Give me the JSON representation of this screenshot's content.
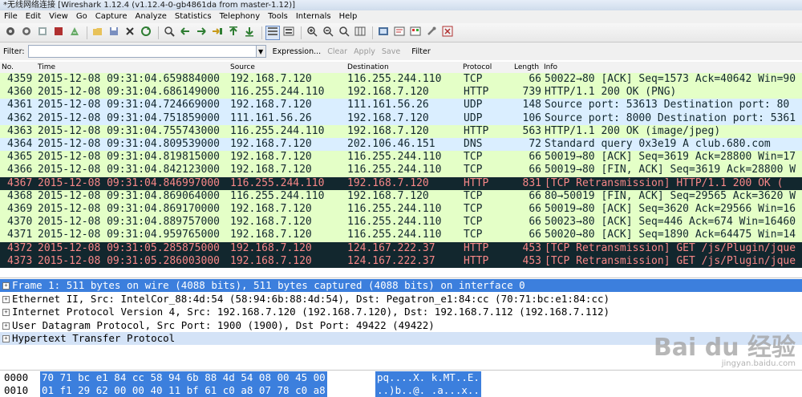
{
  "window": {
    "title": "*无线网络连接   [Wireshark 1.12.4  (v1.12.4-0-gb4861da from master-1.12)]"
  },
  "menu": [
    "File",
    "Edit",
    "View",
    "Go",
    "Capture",
    "Analyze",
    "Statistics",
    "Telephony",
    "Tools",
    "Internals",
    "Help"
  ],
  "toolbar": {
    "icons": [
      "interface-list-icon",
      "capture-options-icon",
      "start-capture-icon",
      "stop-capture-icon",
      "restart-capture-icon",
      "open-file-icon",
      "save-file-icon",
      "close-file-icon",
      "reload-icon",
      "find-packet-icon",
      "go-back-icon",
      "go-forward-icon",
      "go-to-packet-icon",
      "go-first-icon",
      "go-last-icon",
      "colorize-icon",
      "auto-scroll-icon",
      "zoom-in-icon",
      "zoom-out-icon",
      "zoom-normal-icon",
      "resize-columns-icon",
      "capture-filters-icon",
      "display-filters-icon",
      "coloring-rules-icon",
      "preferences-icon",
      "help-icon"
    ]
  },
  "filter": {
    "label": "Filter:",
    "value": "",
    "expression": "Expression...",
    "clear": "Clear",
    "apply": "Apply",
    "save": "Save",
    "filter_btn": "Filter"
  },
  "columns": {
    "no": "No.",
    "time": "Time",
    "source": "Source",
    "destination": "Destination",
    "protocol": "Protocol",
    "length": "Length",
    "info": "Info"
  },
  "colors": {
    "green": "#e4ffc7",
    "blue": "#daeeff",
    "dark": "#12272e",
    "red_text": "#f78787",
    "selected": "#3c7fdd"
  },
  "packets": [
    {
      "no": "4359",
      "time": "2015-12-08 09:31:04.659884000",
      "src": "192.168.7.120",
      "dst": "116.255.244.110",
      "proto": "TCP",
      "len": "66",
      "info": "50022→80 [ACK] Seq=1573 Ack=40642 Win=90",
      "style": "green"
    },
    {
      "no": "4360",
      "time": "2015-12-08 09:31:04.686149000",
      "src": "116.255.244.110",
      "dst": "192.168.7.120",
      "proto": "HTTP",
      "len": "739",
      "info": "HTTP/1.1 200 OK  (PNG)",
      "style": "green"
    },
    {
      "no": "4361",
      "time": "2015-12-08 09:31:04.724669000",
      "src": "192.168.7.120",
      "dst": "111.161.56.26",
      "proto": "UDP",
      "len": "148",
      "info": "Source port: 53613  Destination port: 80",
      "style": "blue"
    },
    {
      "no": "4362",
      "time": "2015-12-08 09:31:04.751859000",
      "src": "111.161.56.26",
      "dst": "192.168.7.120",
      "proto": "UDP",
      "len": "106",
      "info": "Source port: 8000  Destination port: 5361",
      "style": "blue"
    },
    {
      "no": "4363",
      "time": "2015-12-08 09:31:04.755743000",
      "src": "116.255.244.110",
      "dst": "192.168.7.120",
      "proto": "HTTP",
      "len": "563",
      "info": "HTTP/1.1 200 OK  (image/jpeg)",
      "style": "green"
    },
    {
      "no": "4364",
      "time": "2015-12-08 09:31:04.809539000",
      "src": "192.168.7.120",
      "dst": "202.106.46.151",
      "proto": "DNS",
      "len": "72",
      "info": "Standard query 0x3e19  A club.680.com",
      "style": "blue"
    },
    {
      "no": "4365",
      "time": "2015-12-08 09:31:04.819815000",
      "src": "192.168.7.120",
      "dst": "116.255.244.110",
      "proto": "TCP",
      "len": "66",
      "info": "50019→80 [ACK] Seq=3619 Ack=28800 Win=17",
      "style": "green"
    },
    {
      "no": "4366",
      "time": "2015-12-08 09:31:04.842123000",
      "src": "192.168.7.120",
      "dst": "116.255.244.110",
      "proto": "TCP",
      "len": "66",
      "info": "50019→80 [FIN, ACK] Seq=3619 Ack=28800 W",
      "style": "green"
    },
    {
      "no": "4367",
      "time": "2015-12-08 09:31:04.846997000",
      "src": "116.255.244.110",
      "dst": "192.168.7.120",
      "proto": "HTTP",
      "len": "831",
      "info": "[TCP Retransmission] HTTP/1.1 200 OK  (",
      "style": "dark"
    },
    {
      "no": "4368",
      "time": "2015-12-08 09:31:04.869064000",
      "src": "116.255.244.110",
      "dst": "192.168.7.120",
      "proto": "TCP",
      "len": "66",
      "info": "80→50019 [FIN, ACK] Seq=29565 Ack=3620 W",
      "style": "green"
    },
    {
      "no": "4369",
      "time": "2015-12-08 09:31:04.869170000",
      "src": "192.168.7.120",
      "dst": "116.255.244.110",
      "proto": "TCP",
      "len": "66",
      "info": "50019→80 [ACK] Seq=3620 Ack=29566 Win=16",
      "style": "green"
    },
    {
      "no": "4370",
      "time": "2015-12-08 09:31:04.889757000",
      "src": "192.168.7.120",
      "dst": "116.255.244.110",
      "proto": "TCP",
      "len": "66",
      "info": "50023→80 [ACK] Seq=446 Ack=674 Win=16460",
      "style": "green"
    },
    {
      "no": "4371",
      "time": "2015-12-08 09:31:04.959765000",
      "src": "192.168.7.120",
      "dst": "116.255.244.110",
      "proto": "TCP",
      "len": "66",
      "info": "50020→80 [ACK] Seq=1890 Ack=64475 Win=14",
      "style": "green"
    },
    {
      "no": "4372",
      "time": "2015-12-08 09:31:05.285875000",
      "src": "192.168.7.120",
      "dst": "124.167.222.37",
      "proto": "HTTP",
      "len": "453",
      "info": "[TCP Retransmission] GET /js/Plugin/jque",
      "style": "dark"
    },
    {
      "no": "4373",
      "time": "2015-12-08 09:31:05.286003000",
      "src": "192.168.7.120",
      "dst": "124.167.222.37",
      "proto": "HTTP",
      "len": "453",
      "info": "[TCP Retransmission] GET /js/Plugin/jque",
      "style": "dark"
    }
  ],
  "details": [
    {
      "text": "Frame 1: 511 bytes on wire (4088 bits), 511 bytes captured (4088 bits) on interface 0",
      "style": "selected"
    },
    {
      "text": "Ethernet II, Src: IntelCor_88:4d:54 (58:94:6b:88:4d:54), Dst: Pegatron_e1:84:cc (70:71:bc:e1:84:cc)",
      "style": "plain"
    },
    {
      "text": "Internet Protocol Version 4, Src: 192.168.7.120 (192.168.7.120), Dst: 192.168.7.112 (192.168.7.112)",
      "style": "plain"
    },
    {
      "text": "User Datagram Protocol, Src Port: 1900 (1900), Dst Port: 49422 (49422)",
      "style": "plain"
    },
    {
      "text": "Hypertext Transfer Protocol",
      "style": "light"
    }
  ],
  "bytes": [
    {
      "offset": "0000",
      "hex": "70 71 bc e1 84 cc 58 94  6b 88 4d 54 08 00 45 00",
      "ascii": "pq....X. k.MT..E."
    },
    {
      "offset": "0010",
      "hex": "01 f1 29 62 00 00 40 11  bf 61 c0 a8 07 78 c0 a8",
      "ascii": "..)b..@. .a...x.."
    }
  ],
  "watermark": {
    "main": "Bai du 经验",
    "sub": "jingyan.baidu.com"
  }
}
